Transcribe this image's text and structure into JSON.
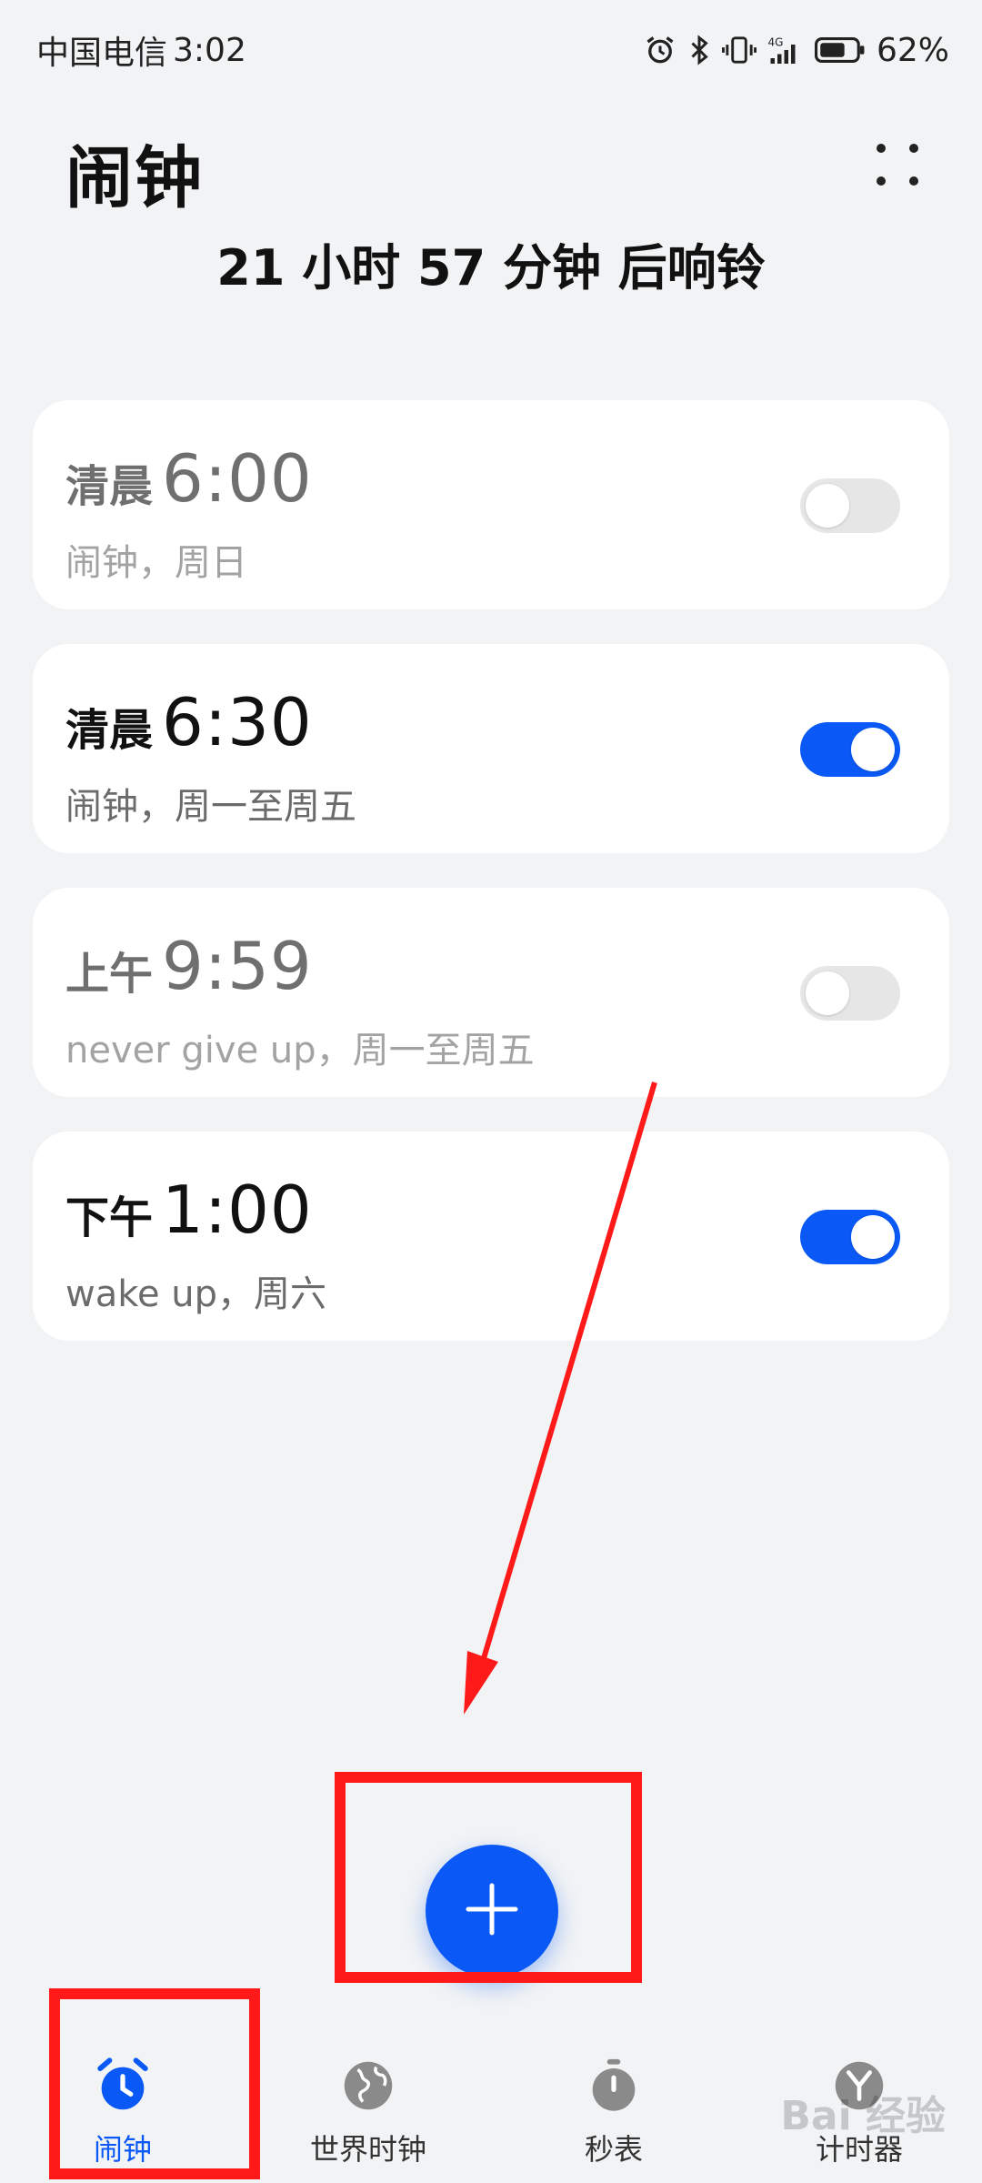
{
  "status_bar": {
    "carrier": "中国电信",
    "time": "3:02",
    "battery": "62%",
    "icons": [
      "alarm-icon",
      "bluetooth-icon",
      "vibrate-icon",
      "signal-4g-icon",
      "battery-icon"
    ]
  },
  "header": {
    "title": "闹钟",
    "more_icon": "more-icon"
  },
  "next_ring": "21 小时 57 分钟 后响铃",
  "alarms": [
    {
      "period": "清晨",
      "time": "6:00",
      "sub": "闹钟，周日",
      "enabled": false
    },
    {
      "period": "清晨",
      "time": "6:30",
      "sub": "闹钟，周一至周五",
      "enabled": true
    },
    {
      "period": "上午",
      "time": "9:59",
      "sub": "never  give  up，周一至周五",
      "enabled": false
    },
    {
      "period": "下午",
      "time": "1:00",
      "sub": "wake up，周六",
      "enabled": true
    }
  ],
  "fab": {
    "icon": "plus-icon"
  },
  "bottom_nav": [
    {
      "label": "闹钟",
      "icon": "alarm-clock-icon",
      "active": true
    },
    {
      "label": "世界时钟",
      "icon": "globe-icon",
      "active": false
    },
    {
      "label": "秒表",
      "icon": "stopwatch-icon",
      "active": false
    },
    {
      "label": "计时器",
      "icon": "timer-icon",
      "active": false
    }
  ],
  "watermark": "Bai 经验",
  "colors": {
    "accent": "#0a59f7",
    "background": "#f1f3f5",
    "card": "#ffffff",
    "annotation": "#ff1a1a"
  }
}
